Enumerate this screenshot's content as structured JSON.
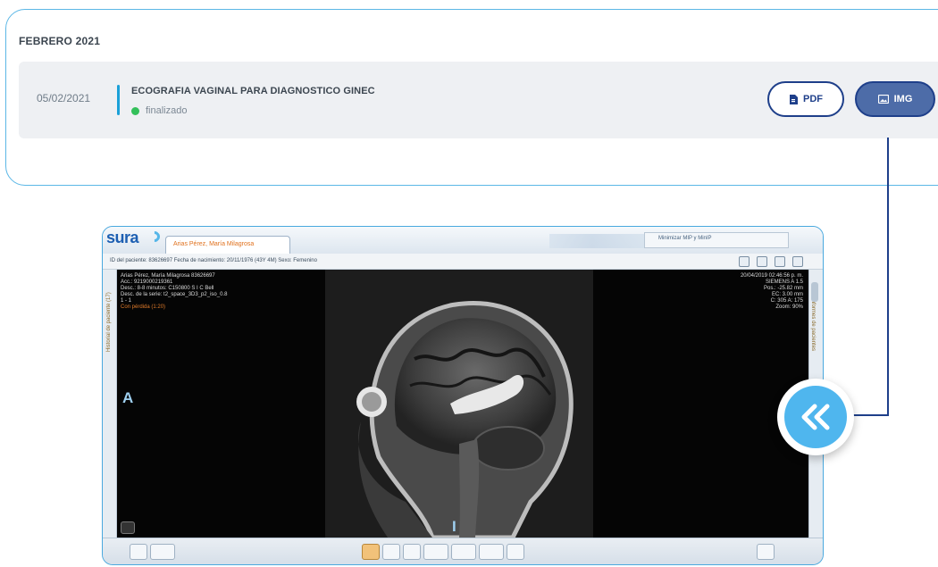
{
  "history": {
    "month_label": "FEBRERO 2021",
    "exam": {
      "date": "05/02/2021",
      "title": "ECOGRAFIA VAGINAL PARA DIAGNOSTICO GINEC",
      "status": "finalizado",
      "status_color": "#33c05a",
      "pdf_label": "PDF",
      "img_label": "IMG"
    }
  },
  "viewer": {
    "brand": "sura",
    "patient_tab": "Arias Pérez, María Milagrosa",
    "top_widget_text": "Minimizar MIP y MinIP",
    "info_line": "ID del paciente: 83626697   Fecha de nacimiento: 20/11/1976 (43Y 4M)   Sexo: Femenino",
    "left_side_label": "Historial de paciente (17)",
    "right_side_label": "Informes de pacientes",
    "overlay_left": [
      "Arias Pérez, María Milagrosa 83626697",
      "Acc.: 9219000219361",
      "Desc.: 8-8 minutos: C150800 S I C Bell",
      "Desc. de la serie: t2_space_3D3_p2_iso_0.8",
      "1 - 1"
    ],
    "overlay_left_warning": "Con pérdida (1:20)",
    "overlay_right": [
      "20/04/2019 02:46:56 p. m.",
      "SIEMENS A 1.5",
      "Pos.: -25.82 mm",
      "EC: 3.00 mm",
      "C: 305 A: 175",
      "Zoom: 90%"
    ],
    "orientation_left": "A",
    "orientation_bottom": "I"
  },
  "colors": {
    "accent": "#1e3f8a",
    "card_border": "#5bb7e6",
    "img_button_bg": "#4d6ca8",
    "collapse_badge": "#4fb6ee"
  }
}
